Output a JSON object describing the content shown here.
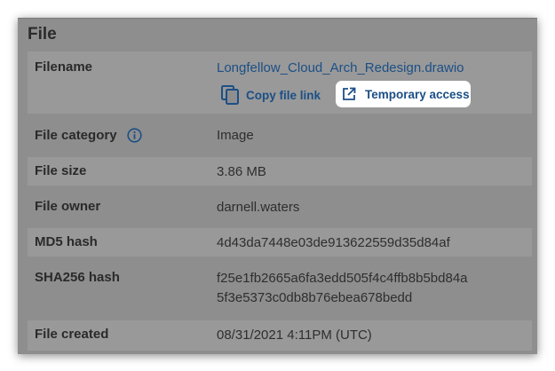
{
  "section": {
    "title": "File"
  },
  "filename": {
    "label": "Filename",
    "value": "Longfellow_Cloud_Arch_Redesign.drawio",
    "copy_link_label": "Copy file link",
    "temporary_access_label": "Temporary access"
  },
  "file_category": {
    "label": "File category",
    "value": "Image",
    "info_icon": "info-icon"
  },
  "file_size": {
    "label": "File size",
    "value": "3.86 MB"
  },
  "file_owner": {
    "label": "File owner",
    "value": "darnell.waters"
  },
  "md5": {
    "label": "MD5 hash",
    "value": "4d43da7448e03de913622559d35d84af"
  },
  "sha256": {
    "label": "SHA256 hash",
    "value_line1": "f25e1fb2665a6fa3edd505f4c4ffb8b5bd84a",
    "value_line2": "5f3e5373c0db8b76ebea678bedd"
  },
  "file_created": {
    "label": "File created",
    "value": "08/31/2021 4:11PM (UTC)"
  },
  "colors": {
    "link": "#1c4f86",
    "overlay": "#8e8e8e",
    "highlight": "#ffffff"
  }
}
